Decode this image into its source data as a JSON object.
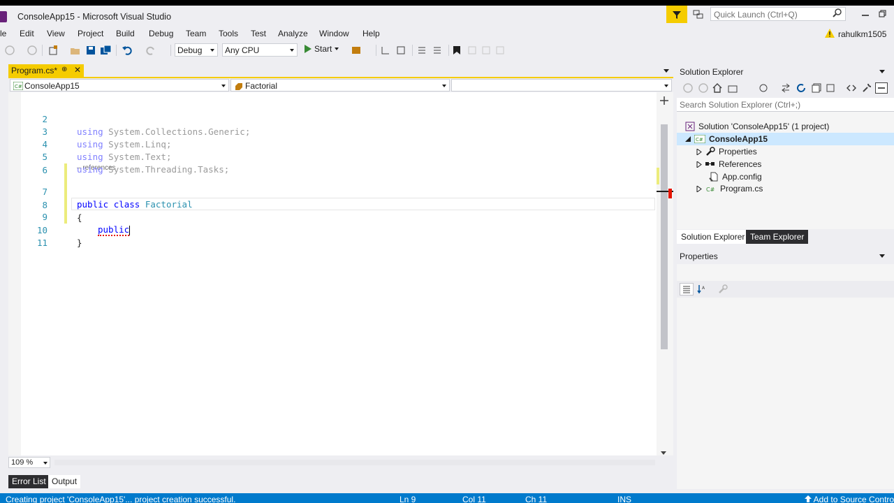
{
  "window": {
    "title": "ConsoleApp15 - Microsoft Visual Studio",
    "quick_launch_placeholder": "Quick Launch (Ctrl+Q)",
    "user": "rahulkm1505"
  },
  "menu": [
    "le",
    "Edit",
    "View",
    "Project",
    "Build",
    "Debug",
    "Team",
    "Tools",
    "Test",
    "Analyze",
    "Window",
    "Help"
  ],
  "toolbar": {
    "configuration": "Debug",
    "platform": "Any CPU",
    "start_label": "Start"
  },
  "editor": {
    "tab_label": "Program.cs*",
    "pin_glyph": "⊕",
    "close_glyph": "✕",
    "nav_project": "ConsoleApp15",
    "nav_type": "Factorial",
    "nav_member": "",
    "zoom": "109 %",
    "codelens": "– references",
    "lines": [
      {
        "n": "2",
        "using": "using",
        "ns": " System.Collections.Generic;"
      },
      {
        "n": "3",
        "using": "using",
        "ns": " System.Linq;"
      },
      {
        "n": "4",
        "using": "using",
        "ns": " System.Text;"
      },
      {
        "n": "5",
        "using": "using",
        "ns": " System.Threading.Tasks;"
      },
      {
        "n": "6"
      },
      {
        "n": "7",
        "kw1": "public",
        "kw2": "class",
        "type": "Factorial"
      },
      {
        "n": "8",
        "text": "{"
      },
      {
        "n": "9",
        "typed": "public"
      },
      {
        "n": "10",
        "text": "}"
      },
      {
        "n": "11"
      }
    ]
  },
  "bottom_tabs": [
    "Error List",
    "Output"
  ],
  "solution_explorer": {
    "title": "Solution Explorer",
    "search_placeholder": "Search Solution Explorer (Ctrl+;)",
    "solution": "Solution 'ConsoleApp15' (1 project)",
    "project": "ConsoleApp15",
    "items": [
      "Properties",
      "References",
      "App.config",
      "Program.cs"
    ],
    "tabs": [
      "Solution Explorer",
      "Team Explorer"
    ]
  },
  "properties": {
    "title": "Properties"
  },
  "status": {
    "message": "Creating project 'ConsoleApp15'... project creation successful.",
    "ln": "Ln 9",
    "col": "Col 11",
    "ch": "Ch 11",
    "mode": "INS",
    "source_control": "Add to Source Control"
  },
  "colors": {
    "accent_yellow": "#f5cc00",
    "status_blue": "#007acc",
    "keyword": "#0000ff",
    "type": "#2b91af"
  }
}
